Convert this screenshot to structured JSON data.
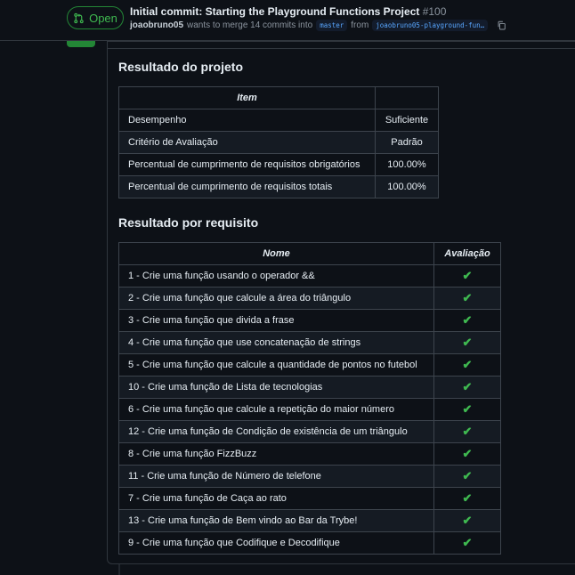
{
  "header": {
    "state": "Open",
    "title": "Initial commit: Starting the Playground Functions Project",
    "number": "#100",
    "author": "joaobruno05",
    "merge_text": "wants to merge 14 commits into",
    "base_branch": "master",
    "from_text": "from",
    "head_branch": "joaobruno05-playground-fun…",
    "icons": {
      "state": "git-pull-request-icon",
      "copy": "copy-icon"
    }
  },
  "project": {
    "heading": "Resultado do projeto",
    "columns": [
      "Item",
      ""
    ],
    "rows": [
      [
        "Desempenho",
        "Suficiente"
      ],
      [
        "Critério de Avaliação",
        "Padrão"
      ],
      [
        "Percentual de cumprimento de requisitos obrigatórios",
        "100.00%"
      ],
      [
        "Percentual de cumprimento de requisitos totais",
        "100.00%"
      ]
    ]
  },
  "requirements": {
    "heading": "Resultado por requisito",
    "columns": [
      "Nome",
      "Avaliação"
    ],
    "rows": [
      [
        "1 - Crie uma função usando o operador &&",
        "✔"
      ],
      [
        "2 - Crie uma função que calcule a área do triângulo",
        "✔"
      ],
      [
        "3 - Crie uma função que divida a frase",
        "✔"
      ],
      [
        "4 - Crie uma função que use concatenação de strings",
        "✔"
      ],
      [
        "5 - Crie uma função que calcule a quantidade de pontos no futebol",
        "✔"
      ],
      [
        "10 - Crie uma função de Lista de tecnologias",
        "✔"
      ],
      [
        "6 - Crie uma função que calcule a repetição do maior número",
        "✔"
      ],
      [
        "12 - Crie uma função de Condição de existência de um triângulo",
        "✔"
      ],
      [
        "8 - Crie uma função FizzBuzz",
        "✔"
      ],
      [
        "11 - Crie uma função de Número de telefone",
        "✔"
      ],
      [
        "7 - Crie uma função de Caça ao rato",
        "✔"
      ],
      [
        "13 - Crie uma função de Bem vindo ao Bar da Trybe!",
        "✔"
      ],
      [
        "9 - Crie uma função que Codifique e Decodifique",
        "✔"
      ]
    ]
  },
  "colors": {
    "open": "#3fb950",
    "open_border": "#238636",
    "link": "#58a6ff"
  }
}
